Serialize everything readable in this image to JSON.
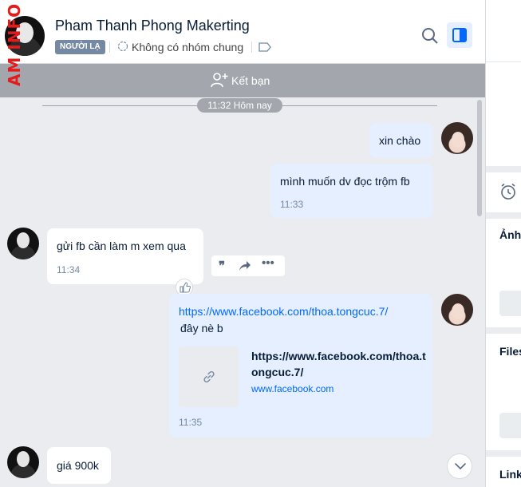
{
  "header": {
    "contact_name": "Pham Thanh Phong Makerting",
    "badge": "NGƯỜI LẠ",
    "group_status": "Không có nhóm chung",
    "watermark": "AM INFO"
  },
  "friend_bar": {
    "label": "Kết bạn"
  },
  "chat": {
    "date_divider": "11:32 Hôm nay",
    "messages": [
      {
        "sender": "me",
        "text": "xin chào",
        "time": ""
      },
      {
        "sender": "me",
        "text": "mình muốn dv đọc trộm fb",
        "time": "11:33"
      },
      {
        "sender": "them",
        "text": "gửi fb cần làm m xem qua",
        "time": "11:34"
      },
      {
        "sender": "me",
        "link": "https://www.facebook.com/thoa.tongcuc.7/",
        "text": "đây nè b",
        "preview_title": "https://www.facebook.com/thoa.tongcuc.7/",
        "preview_domain": "www.facebook.com",
        "time": "11:35"
      },
      {
        "sender": "them",
        "text": "giá 900k",
        "time": ""
      }
    ]
  },
  "right_panel": {
    "images_label": "Ảnh/",
    "files_label": "Files",
    "links_label": "Link"
  },
  "colors": {
    "accent": "#0068ff",
    "my_bubble": "#e5efff",
    "chat_bg": "#ebecf0",
    "friend_bar": "#a3a7ad",
    "badge": "#7589a3"
  },
  "icons": [
    "search-icon",
    "sidebar-toggle-icon",
    "add-friend-icon",
    "group-icon",
    "tag-icon",
    "quote-icon",
    "share-icon",
    "more-icon",
    "like-icon",
    "link-icon",
    "chevron-down-icon",
    "alarm-icon"
  ]
}
